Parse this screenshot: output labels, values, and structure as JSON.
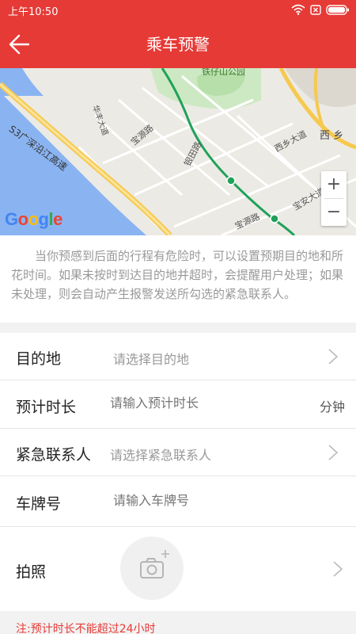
{
  "status_bar": {
    "time": "上午10:50",
    "icons": [
      "wifi-icon",
      "sim-icon",
      "battery-icon"
    ]
  },
  "header": {
    "title": "乘车预警",
    "back_icon": "arrow-left-icon",
    "background_color": "#e63a36"
  },
  "map": {
    "labels": {
      "park": "铁仔山公园",
      "expressway": "S3广深沿江高速",
      "road_baoyuan_1": "宝源路",
      "road_baoyuan_2": "宝源路",
      "road_yintian": "银田路",
      "road_xixiang": "西乡大道",
      "road_baoan": "宝安大道",
      "area_xixiang": "西 乡",
      "road_side": "华丰大道"
    },
    "provider": "Google",
    "zoom_in_label": "+",
    "zoom_out_label": "−",
    "route_color": "#1fa15a"
  },
  "notice": {
    "text": "当你预感到后面的行程有危险时，可以设置预期目的地和所花时间。如果未按时到达目的地并超时，会提醒用户处理；如果未处理，则会自动产生报警发送所勾选的紧急联系人。"
  },
  "form": {
    "destination": {
      "label": "目的地",
      "placeholder": "请选择目的地"
    },
    "duration": {
      "label": "预计时长",
      "placeholder": "请输入预计时长",
      "unit": "分钟"
    },
    "contact": {
      "label": "紧急联系人",
      "placeholder": "请选择紧急联系人"
    },
    "plate": {
      "label": "车牌号",
      "placeholder": "请输入车牌号"
    },
    "photo": {
      "label": "拍照",
      "camera_icon": "camera-add-icon"
    }
  },
  "footer": {
    "note": "注:预计时长不能超过24小时",
    "note_color": "#e63a36"
  }
}
